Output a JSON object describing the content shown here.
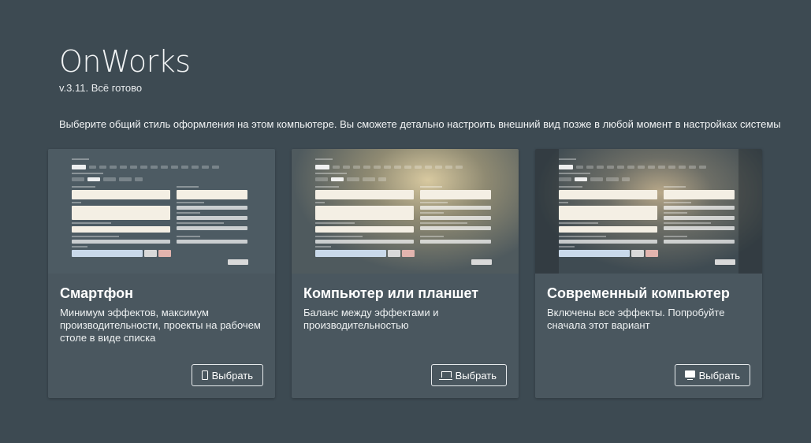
{
  "header": {
    "title": "OnWorks",
    "version": "v.3.11. Всё готово",
    "intro": "Выберите общий стиль оформления на этом компьютере. Вы сможете детально настроить внешний вид позже в любой момент в настройках системы"
  },
  "cards": [
    {
      "title": "Смартфон",
      "description": "Минимум эффектов, максимум производительности, проекты на рабочем столе в виде списка",
      "button_label": "Выбрать",
      "icon": "phone-icon",
      "preview_style": "flat"
    },
    {
      "title": "Компьютер или планшет",
      "description": "Баланс между эффектами и производительностью",
      "button_label": "Выбрать",
      "icon": "laptop-icon",
      "preview_style": "warm"
    },
    {
      "title": "Современный компьютер",
      "description": "Включены все эффекты. Попробуйте сначала этот вариант",
      "button_label": "Выбрать",
      "icon": "desktop-icon",
      "preview_style": "blur"
    }
  ],
  "colors": {
    "background": "#3d4a52",
    "card": "#4a575f",
    "text": "#ffffff"
  }
}
